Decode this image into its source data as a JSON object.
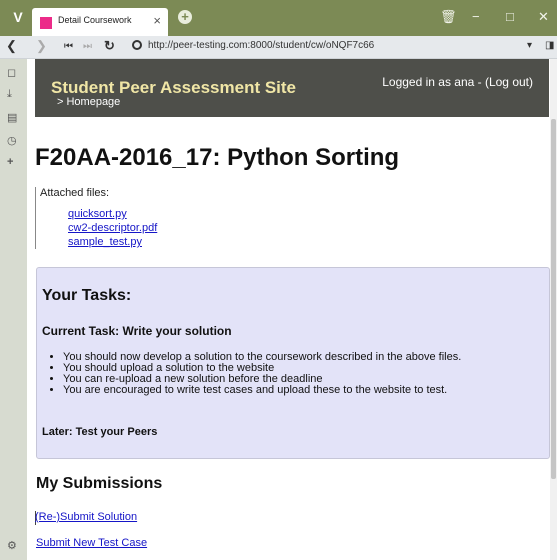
{
  "browser": {
    "logo": "V",
    "tab_title": "Detail Coursework",
    "tab_close": "×",
    "new_tab": "+",
    "url": "http://peer-testing.com:8000/student/cw/oNQF7c66",
    "window_trash": "🗑",
    "window_min": "−",
    "window_max": "□",
    "window_close": "✕",
    "addr_dropdown": "▾",
    "addr_extra": "◨"
  },
  "side_icons": [
    "bookmark-icon",
    "download-icon",
    "notes-icon",
    "history-icon",
    "add-panel-icon",
    "settings-icon"
  ],
  "header": {
    "site_title": "Student Peer Assessment Site",
    "home_link": "> Homepage",
    "login_status": "Logged in as ana - (Log out)"
  },
  "page": {
    "title": "F20AA-2016_17: Python Sorting",
    "attached_label": "Attached files:",
    "files": [
      "quicksort.py",
      "cw2-descriptor.pdf",
      "sample_test.py"
    ]
  },
  "tasks": {
    "heading": "Your Tasks:",
    "current": "Current Task: Write your solution",
    "items": [
      "You should now develop a solution to the coursework described in the above files.",
      "You should upload a solution to the website",
      "You can re-upload a new solution before the deadline",
      "You are encouraged to write test cases and upload these to the website to test."
    ],
    "later": "Later: Test your Peers"
  },
  "submissions": {
    "heading": "My Submissions",
    "resubmit": "(Re-)Submit Solution",
    "new_test": "Submit New Test Case"
  }
}
